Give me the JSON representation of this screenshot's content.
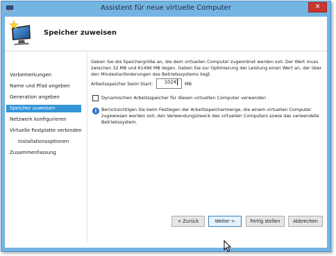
{
  "window": {
    "title": "Assistent für neue virtuelle Computer",
    "close_label": "✕"
  },
  "header": {
    "heading": "Speicher zuweisen"
  },
  "sidebar": {
    "items": [
      {
        "label": "Vorbemerkungen",
        "active": false,
        "sub": false
      },
      {
        "label": "Name und Pfad angeben",
        "active": false,
        "sub": false
      },
      {
        "label": "Generation angeben",
        "active": false,
        "sub": false
      },
      {
        "label": "Speicher zuweisen",
        "active": true,
        "sub": false
      },
      {
        "label": "Netzwerk konfigurieren",
        "active": false,
        "sub": false
      },
      {
        "label": "Virtuelle Festplatte verbinden",
        "active": false,
        "sub": false
      },
      {
        "label": "Installationsoptionen",
        "active": false,
        "sub": true
      },
      {
        "label": "Zusammenfassung",
        "active": false,
        "sub": false
      }
    ]
  },
  "main": {
    "description": "Geben Sie die Speichergröße an, die dem virtuellen Computer zugeordnet werden soll. Der Wert muss zwischen 32 MB und 61496 MB liegen. Geben Sie zur Optimierung der Leistung einen Wert an, der über den Mindestanforderungen des Betriebssystems liegt.",
    "ram_label": "Arbeitsspeicher beim Start:",
    "ram_value": "1024",
    "ram_unit": "MB",
    "dynamic_memory_label": "Dynamischen Arbeitsspeicher für diesen virtuellen Computer verwenden",
    "dynamic_memory_checked": false,
    "info_text": "Berücksichtigen Sie beim Festlegen der Arbeitsspeichermenge, die einem virtuellen Computer zugewiesen werden soll, den Verwendungszweck des virtuellen Computers sowie das verwendete Betriebssystem."
  },
  "buttons": {
    "back": "< Zurück",
    "next": "Weiter >",
    "finish": "Fertig stellen",
    "cancel": "Abbrechen"
  },
  "colors": {
    "title_bar": "#74b4e3",
    "nav_active": "#3394d6",
    "close_button": "#c7372f"
  }
}
